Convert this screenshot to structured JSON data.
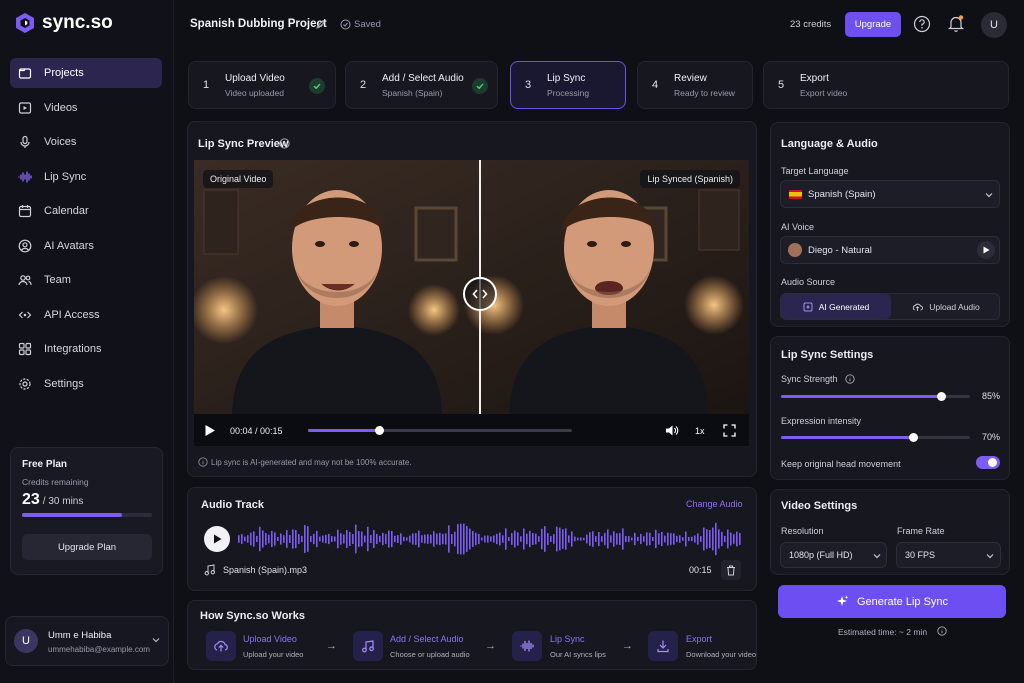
{
  "brand": {
    "name": "sync.so",
    "accent": "#7d5cf2"
  },
  "sidebar": {
    "items": [
      {
        "label": "Projects",
        "icon": "projects-icon"
      },
      {
        "label": "Videos",
        "icon": "video-icon"
      },
      {
        "label": "Voices",
        "icon": "microphone-icon"
      },
      {
        "label": "Lip Sync",
        "icon": "waveform-icon"
      },
      {
        "label": "Calendar",
        "icon": "calendar-icon"
      },
      {
        "label": "AI Avatars",
        "icon": "avatar-icon"
      },
      {
        "label": "Team",
        "icon": "team-icon"
      },
      {
        "label": "API Access",
        "icon": "api-icon"
      },
      {
        "label": "Integrations",
        "icon": "integrations-icon"
      },
      {
        "label": "Settings",
        "icon": "gear-icon"
      }
    ],
    "plan": {
      "title": "Free Plan",
      "subtitle": "Credits remaining",
      "credits_used": "23",
      "credits_total": "/ 30 mins",
      "progress": 0.77,
      "button": "Upgrade Plan"
    },
    "user": {
      "initial": "U",
      "name": "Umm e Habiba",
      "email": "ummehabiba@example.com"
    }
  },
  "header": {
    "project_title": "Spanish Dubbing Project",
    "save_status": "Saved",
    "credits": "23 credits",
    "upgrade": "Upgrade",
    "avatar_initial": "U"
  },
  "steps": [
    {
      "num": "1",
      "title": "Upload Video",
      "sub": "Video uploaded",
      "done": true
    },
    {
      "num": "2",
      "title": "Add / Select Audio",
      "sub": "Spanish (Spain)",
      "done": true
    },
    {
      "num": "3",
      "title": "Lip Sync",
      "sub": "Processing",
      "active": true
    },
    {
      "num": "4",
      "title": "Review",
      "sub": "Ready to review"
    },
    {
      "num": "5",
      "title": "Export",
      "sub": "Export video"
    }
  ],
  "preview": {
    "title": "Lip Sync Preview",
    "left_tag": "Original Video",
    "right_tag": "Lip Synced (Spanish)",
    "time": "00:04 / 00:15",
    "progress": 0.27,
    "speed": "1x",
    "note": "Lip sync is AI-generated and may not be 100% accurate."
  },
  "audio_track": {
    "title": "Audio Track",
    "change": "Change Audio",
    "file": "Spanish (Spain).mp3",
    "duration": "00:15"
  },
  "how": {
    "title": "How Sync.so Works",
    "steps": [
      {
        "title": "Upload Video",
        "sub": "Upload your video"
      },
      {
        "title": "Add / Select Audio",
        "sub": "Choose or upload audio"
      },
      {
        "title": "Lip Sync",
        "sub": "Our AI syncs lips"
      },
      {
        "title": "Export",
        "sub": "Download your video"
      }
    ]
  },
  "language_audio": {
    "title": "Language & Audio",
    "target_label": "Target Language",
    "target_value": "Spanish (Spain)",
    "voice_label": "AI Voice",
    "voice_value": "Diego - Natural",
    "source_label": "Audio Source",
    "source_ai": "AI Generated",
    "source_upload": "Upload Audio"
  },
  "lipsync_settings": {
    "title": "Lip Sync Settings",
    "strength_label": "Sync Strength",
    "strength_value": "85%",
    "strength": 0.85,
    "expression_label": "Expression intensity",
    "expression_value": "70%",
    "expression": 0.7,
    "head_label": "Keep original head movement",
    "head_on": true
  },
  "video_settings": {
    "title": "Video Settings",
    "res_label": "Resolution",
    "res_value": "1080p (Full HD)",
    "fps_label": "Frame Rate",
    "fps_value": "30 FPS"
  },
  "generate": {
    "label": "Generate Lip Sync",
    "estimate": "Estimated time: ~ 2 min"
  }
}
